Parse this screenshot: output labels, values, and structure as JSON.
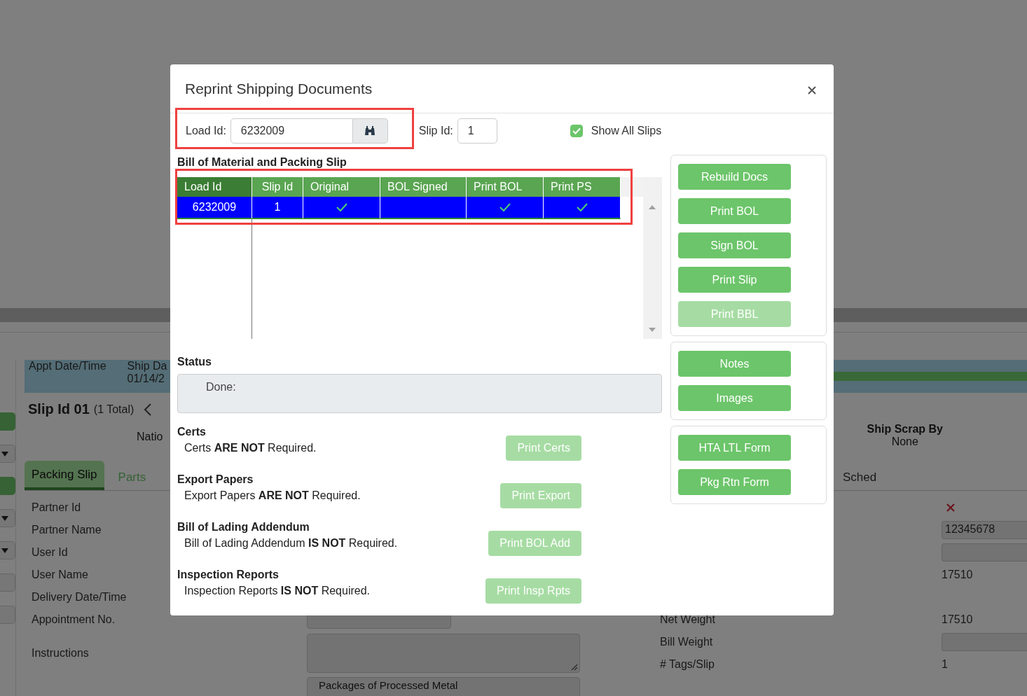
{
  "page": {
    "appt_label": "Appt Date/Time",
    "ship_label": "Ship Da",
    "ship_value": "01/14/2",
    "slip_title": "Slip Id 01",
    "slip_count": "(1 Total)",
    "nation": "Natio",
    "ship_scrap": {
      "label": "Ship Scrap By",
      "value": "None"
    },
    "tabs": [
      {
        "label": "Packing Slip",
        "selected": true
      },
      {
        "label": "Parts",
        "selected": false
      }
    ],
    "tab_right": "Sched",
    "edge_controls": [
      {
        "kind": "search"
      },
      {
        "kind": "dropdown"
      },
      {
        "kind": "search"
      },
      {
        "kind": "dropdown"
      },
      {
        "kind": "dropdown"
      },
      {
        "kind": "field"
      },
      {
        "kind": "field"
      }
    ],
    "labels": [
      "Partner Id",
      "Partner Name",
      "User Id",
      "User Name",
      "Delivery Date/Time",
      "Appointment No.",
      "Instructions"
    ],
    "right_labels": [
      "Net Weight",
      "Bill Weight",
      "# Tags/Slip"
    ],
    "partner_id_valid": false,
    "partner_name_value": "12345678",
    "user_name_value": "17510",
    "net_weight_value": "17510",
    "tags_value": "1",
    "description_value": "Packages of Processed Metal"
  },
  "dialog": {
    "title": "Reprint Shipping Documents",
    "load_id": {
      "label": "Load Id:",
      "value": "6232009",
      "highlighted": true
    },
    "slip_id": {
      "label": "Slip Id:",
      "value": "1"
    },
    "show_all_slips": {
      "label": "Show All Slips",
      "checked": true
    },
    "grid": {
      "title": "Bill of Material and Packing Slip",
      "highlighted": true,
      "columns": [
        "Load Id",
        "Slip Id",
        "Original",
        "BOL Signed",
        "Print BOL",
        "Print PS"
      ],
      "rows": [
        {
          "load_id": "6232009",
          "slip_id": "1",
          "original": true,
          "bol_signed": false,
          "print_bol": true,
          "print_ps": true,
          "selected": true
        }
      ]
    },
    "status": {
      "label": "Status",
      "text": "Done:"
    },
    "requirements": [
      {
        "title": "Certs",
        "sentence": "Certs **ARE NOT** Required.",
        "button": "Print Certs",
        "disabled": true
      },
      {
        "title": "Export Papers",
        "sentence": "Export Papers **ARE NOT** Required.",
        "button": "Print Export",
        "disabled": true
      },
      {
        "title": "Bill of Lading Addendum",
        "sentence": "Bill of Lading Addendum **IS NOT** Required.",
        "button": "Print BOL Add",
        "disabled": true
      },
      {
        "title": "Inspection Reports",
        "sentence": "Inspection Reports **IS NOT** Required.",
        "button": "Print Insp Rpts",
        "disabled": true
      }
    ],
    "button_groups": [
      [
        {
          "label": "Rebuild Docs",
          "disabled": false
        },
        {
          "label": "Print BOL",
          "disabled": false
        },
        {
          "label": "Sign BOL",
          "disabled": false
        },
        {
          "label": "Print Slip",
          "disabled": false
        },
        {
          "label": "Print BBL",
          "disabled": true
        }
      ],
      [
        {
          "label": "Notes",
          "disabled": false
        },
        {
          "label": "Images",
          "disabled": false
        }
      ],
      [
        {
          "label": "HTA LTL Form",
          "disabled": false
        },
        {
          "label": "Pkg Rtn Form",
          "disabled": false
        }
      ]
    ]
  }
}
